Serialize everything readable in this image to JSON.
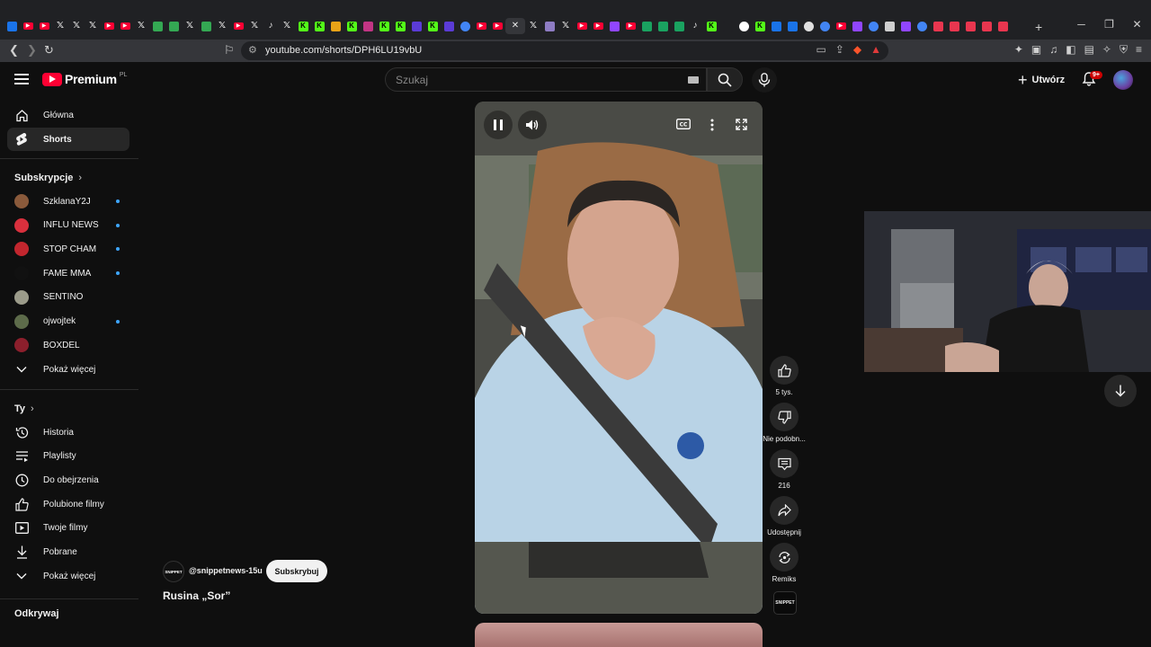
{
  "browser": {
    "url": "youtube.com/shorts/DPH6LU19vbU",
    "tabs": [
      {
        "icon": "messenger-icon",
        "color": "#1a73e8",
        "glyph": ""
      },
      {
        "icon": "youtube-icon",
        "color": "#ff0033",
        "glyph": "▶"
      },
      {
        "icon": "youtube-icon",
        "color": "#ff0033",
        "glyph": "▶"
      },
      {
        "icon": "x-icon",
        "color": "#202124",
        "glyph": "𝕏"
      },
      {
        "icon": "x-icon",
        "color": "#202124",
        "glyph": "𝕏"
      },
      {
        "icon": "x-icon",
        "color": "#202124",
        "glyph": "𝕏"
      },
      {
        "icon": "youtube-icon",
        "color": "#ff0033",
        "glyph": "▶"
      },
      {
        "icon": "youtube-icon",
        "color": "#ff0033",
        "glyph": "▶"
      },
      {
        "icon": "x-icon",
        "color": "#202124",
        "glyph": "𝕏"
      },
      {
        "icon": "maps-icon",
        "color": "#34a853",
        "glyph": ""
      },
      {
        "icon": "maps-icon",
        "color": "#34a853",
        "glyph": ""
      },
      {
        "icon": "x-icon",
        "color": "#202124",
        "glyph": "𝕏"
      },
      {
        "icon": "maps-icon",
        "color": "#34a853",
        "glyph": ""
      },
      {
        "icon": "x-icon",
        "color": "#202124",
        "glyph": "𝕏"
      },
      {
        "icon": "youtube-icon",
        "color": "#ff0033",
        "glyph": "▶"
      },
      {
        "icon": "x-icon",
        "color": "#202124",
        "glyph": "𝕏"
      },
      {
        "icon": "tiktok-icon",
        "color": "#202124",
        "glyph": "♪"
      },
      {
        "icon": "x-icon",
        "color": "#202124",
        "glyph": "𝕏"
      },
      {
        "icon": "kick-icon",
        "color": "#53fc18",
        "glyph": "K"
      },
      {
        "icon": "kick-icon",
        "color": "#53fc18",
        "glyph": "K"
      },
      {
        "icon": "dot-icon",
        "color": "#e8a317",
        "glyph": ""
      },
      {
        "icon": "kick-icon",
        "color": "#53fc18",
        "glyph": "K"
      },
      {
        "icon": "instagram-icon",
        "color": "#c13584",
        "glyph": ""
      },
      {
        "icon": "kick-icon",
        "color": "#53fc18",
        "glyph": "K"
      },
      {
        "icon": "kick-icon",
        "color": "#53fc18",
        "glyph": "K"
      },
      {
        "icon": "tip-icon",
        "color": "#5b3bd6",
        "glyph": ""
      },
      {
        "icon": "kick-icon",
        "color": "#53fc18",
        "glyph": "K"
      },
      {
        "icon": "tip-icon",
        "color": "#5b3bd6",
        "glyph": ""
      },
      {
        "icon": "chrome-icon",
        "color": "#4285f4",
        "glyph": ""
      },
      {
        "icon": "youtube-icon",
        "color": "#ff0033",
        "glyph": "▶"
      },
      {
        "icon": "youtube-icon",
        "color": "#ff0033",
        "glyph": "▶"
      },
      {
        "icon": "close-icon",
        "color": "#35363a",
        "glyph": "✕"
      },
      {
        "icon": "x-icon",
        "color": "#202124",
        "glyph": "𝕏"
      },
      {
        "icon": "pen-icon",
        "color": "#8e7cc3",
        "glyph": ""
      },
      {
        "icon": "x-icon",
        "color": "#202124",
        "glyph": "𝕏"
      },
      {
        "icon": "youtube-icon",
        "color": "#ff0033",
        "glyph": "▶"
      },
      {
        "icon": "youtube-icon",
        "color": "#ff0033",
        "glyph": "▶"
      },
      {
        "icon": "twitch-icon",
        "color": "#9146ff",
        "glyph": ""
      },
      {
        "icon": "youtube-icon",
        "color": "#ff0033",
        "glyph": "▶"
      },
      {
        "icon": "chat-icon",
        "color": "#1aa260",
        "glyph": ""
      },
      {
        "icon": "chat-icon",
        "color": "#1aa260",
        "glyph": ""
      },
      {
        "icon": "chat-icon",
        "color": "#1aa260",
        "glyph": ""
      },
      {
        "icon": "tiktok-icon",
        "color": "#202124",
        "glyph": "♪"
      },
      {
        "icon": "kick-icon",
        "color": "#53fc18",
        "glyph": "K"
      },
      {
        "icon": "tt-icon",
        "color": "#202124",
        "glyph": ""
      },
      {
        "icon": "record-icon",
        "color": "#ffffff",
        "glyph": ""
      },
      {
        "icon": "kick-icon",
        "color": "#53fc18",
        "glyph": "K"
      },
      {
        "icon": "docs-icon",
        "color": "#1a73e8",
        "glyph": ""
      },
      {
        "icon": "cloud-icon",
        "color": "#1a73e8",
        "glyph": ""
      },
      {
        "icon": "github-icon",
        "color": "#e0e0e0",
        "glyph": ""
      },
      {
        "icon": "chrome-icon",
        "color": "#4285f4",
        "glyph": ""
      },
      {
        "icon": "youtube-icon",
        "color": "#ff0033",
        "glyph": "▶"
      },
      {
        "icon": "twitch-icon",
        "color": "#9146ff",
        "glyph": ""
      },
      {
        "icon": "chrome-icon",
        "color": "#4285f4",
        "glyph": ""
      },
      {
        "icon": "link-icon",
        "color": "#cfcfcf",
        "glyph": ""
      },
      {
        "icon": "twitch-icon",
        "color": "#9146ff",
        "glyph": ""
      },
      {
        "icon": "chrome-icon",
        "color": "#4285f4",
        "glyph": ""
      },
      {
        "icon": "app-icon",
        "color": "#e8364f",
        "glyph": ""
      },
      {
        "icon": "app-icon",
        "color": "#e8364f",
        "glyph": ""
      },
      {
        "icon": "app-icon",
        "color": "#e8364f",
        "glyph": ""
      },
      {
        "icon": "app-icon",
        "color": "#e8364f",
        "glyph": ""
      },
      {
        "icon": "app-icon",
        "color": "#e8364f",
        "glyph": ""
      }
    ],
    "active_tab_index": 31
  },
  "header": {
    "logo_text": "Premium",
    "logo_country": "PL",
    "search_placeholder": "Szukaj",
    "create_label": "Utwórz",
    "notifications_badge": "9+"
  },
  "sidebar": {
    "main": [
      {
        "label": "Główna",
        "icon": "home-icon",
        "active": false
      },
      {
        "label": "Shorts",
        "icon": "shorts-icon",
        "active": true
      }
    ],
    "subscriptions_heading": "Subskrypcje",
    "subscriptions": [
      {
        "label": "SzklanaY2J",
        "color": "#8a5a3b",
        "dot": true
      },
      {
        "label": "INFLU NEWS",
        "color": "#d9303d",
        "dot": true
      },
      {
        "label": "STOP CHAM",
        "color": "#c2262e",
        "dot": true
      },
      {
        "label": "FAME MMA",
        "color": "#111111",
        "dot": true
      },
      {
        "label": "SENTINO",
        "color": "#9b9b8a",
        "dot": false
      },
      {
        "label": "ojwojtek",
        "color": "#5d6b4a",
        "dot": true
      },
      {
        "label": "BOXDEL",
        "color": "#8c1f2c",
        "dot": false
      }
    ],
    "subscriptions_more": "Pokaż więcej",
    "you_heading": "Ty",
    "you_items": [
      {
        "label": "Historia",
        "icon": "history-icon"
      },
      {
        "label": "Playlisty",
        "icon": "playlist-icon"
      },
      {
        "label": "Do obejrzenia",
        "icon": "clock-icon"
      },
      {
        "label": "Polubione filmy",
        "icon": "thumb-up-icon"
      },
      {
        "label": "Twoje filmy",
        "icon": "video-icon"
      },
      {
        "label": "Pobrane",
        "icon": "download-icon"
      },
      {
        "label": "Pokaż więcej",
        "icon": "chevron-down-icon"
      }
    ],
    "explore_heading": "Odkrywaj"
  },
  "short": {
    "channel_handle": "@snippetnews-15u",
    "channel_logo_text": "SNIPPET",
    "subscribe_label": "Subskrybuj",
    "title": "Rusina „Sor”",
    "likes": "5 tys.",
    "dislike_label": "Nie podobn...",
    "comments": "216",
    "share_label": "Udostępnij",
    "remix_label": "Remiks"
  }
}
